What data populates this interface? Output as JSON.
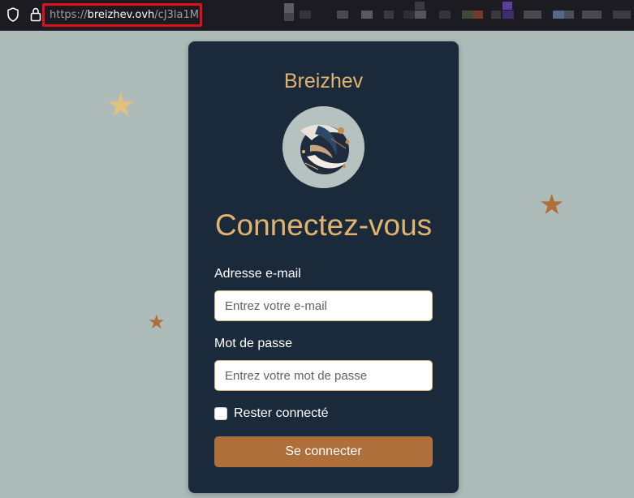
{
  "browser": {
    "url_scheme": "https://",
    "url_host": "breizhev.ovh",
    "url_path": "/cJ3la1M"
  },
  "login": {
    "brand": "Breizhev",
    "heading": "Connectez-vous",
    "email_label": "Adresse e-mail",
    "email_placeholder": "Entrez votre e-mail",
    "email_value": "",
    "password_label": "Mot de passe",
    "password_placeholder": "Entrez votre mot de passe",
    "password_value": "",
    "remember_label": "Rester connecté",
    "remember_checked": false,
    "submit_label": "Se connecter"
  },
  "colors": {
    "page_background": "#aebcb9",
    "card_background": "#1b2a3b",
    "accent_gold": "#e2b36e",
    "button": "#ae6f3b",
    "url_highlight_border": "#e0101a"
  },
  "icons": [
    "shield-icon",
    "lock-icon",
    "star-icon",
    "logo-emblem"
  ]
}
